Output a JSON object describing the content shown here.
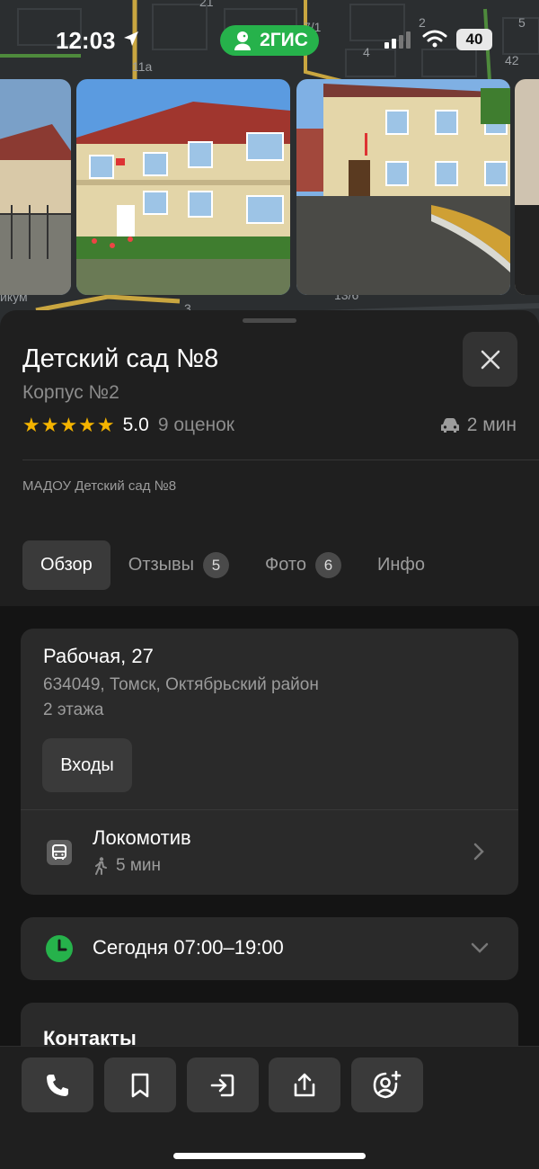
{
  "status_bar": {
    "time": "12:03",
    "app_badge": "2ГИС",
    "battery": "40"
  },
  "map": {
    "labels": [
      "21",
      "11а",
      "7/1",
      "2",
      "5",
      "4",
      "42",
      "13/6",
      "икум",
      "3"
    ]
  },
  "place": {
    "title": "Детский сад №8",
    "subtitle": "Корпус №2",
    "rating_value": "5.0",
    "rating_count": "9 оценок",
    "stars": "★★★★★",
    "drive_time": "2 мин",
    "org_name": "МАДОУ Детский сад №8"
  },
  "tabs": [
    {
      "label": "Обзор",
      "badge": null,
      "active": true
    },
    {
      "label": "Отзывы",
      "badge": "5",
      "active": false
    },
    {
      "label": "Фото",
      "badge": "6",
      "active": false
    },
    {
      "label": "Инфо",
      "badge": null,
      "active": false
    }
  ],
  "address": {
    "street": "Рабочая, 27",
    "city": "634049, Томск, Октябрьский район",
    "floors": "2 этажа",
    "entrances_label": "Входы"
  },
  "transit": {
    "stop_name": "Локомотив",
    "walk_time": "5 мин"
  },
  "hours": {
    "text": "Сегодня 07:00–19:00"
  },
  "contacts": {
    "title": "Контакты"
  },
  "actions": [
    {
      "icon": "phone-icon"
    },
    {
      "icon": "bookmark-icon"
    },
    {
      "icon": "route-enter-icon"
    },
    {
      "icon": "share-icon"
    },
    {
      "icon": "add-friend-icon"
    }
  ],
  "colors": {
    "accent_green": "#26b24b",
    "star": "#f4b400",
    "sheet_bg": "#1f1f1f",
    "card_bg": "#2a2a2a"
  }
}
